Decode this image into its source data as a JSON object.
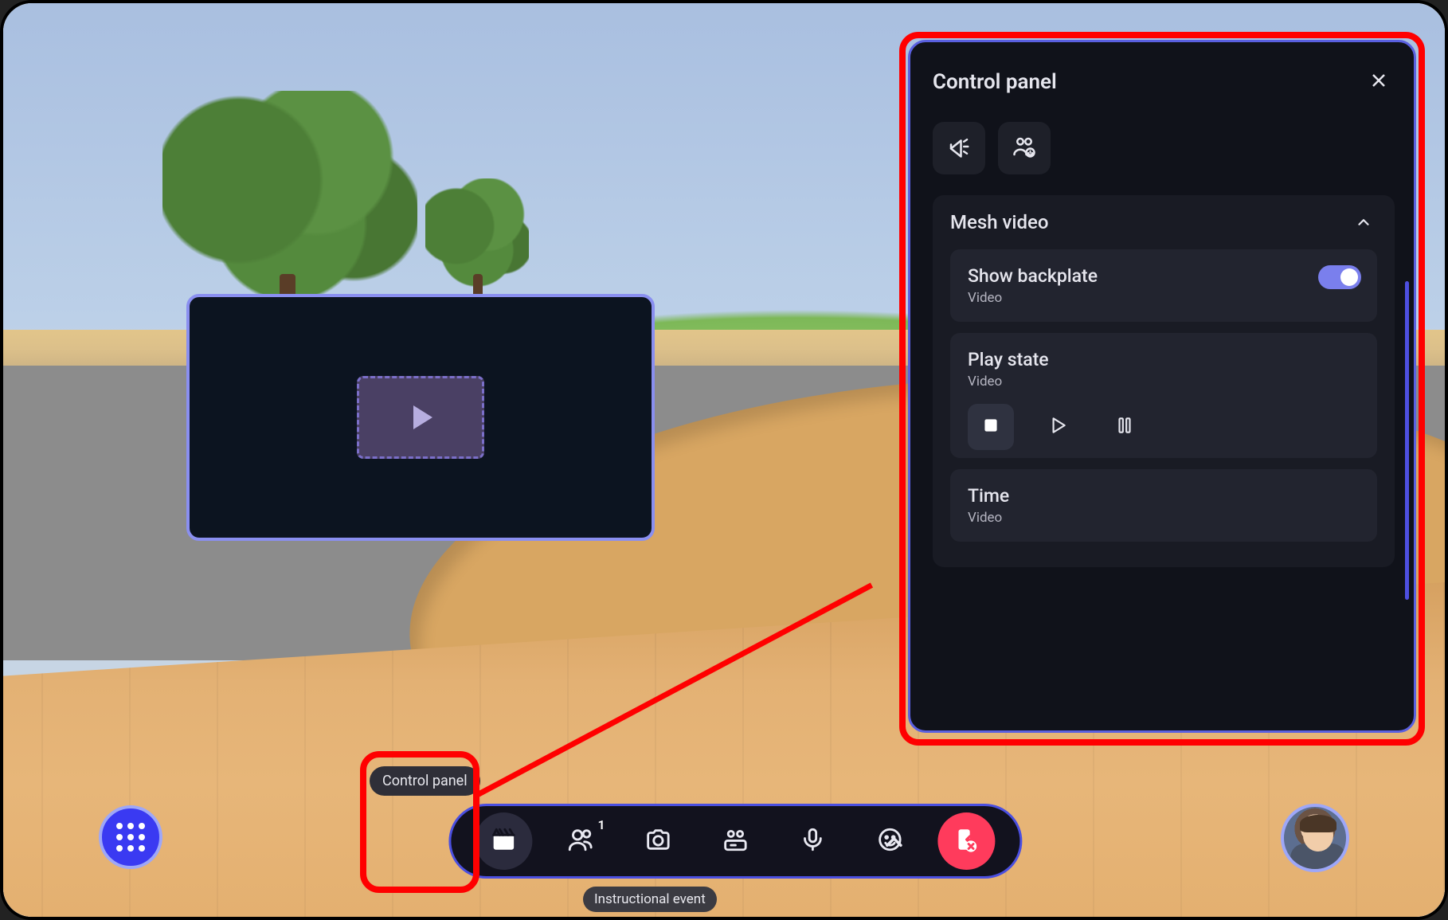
{
  "tooltip": {
    "control_panel": "Control panel",
    "instructional_event": "Instructional event"
  },
  "toolbar": {
    "participant_count": "1"
  },
  "control_panel": {
    "title": "Control panel",
    "section": {
      "mesh_video": {
        "title": "Mesh video",
        "expanded": true,
        "cards": {
          "show_backplate": {
            "label": "Show backplate",
            "sub": "Video",
            "toggle_on": true
          },
          "play_state": {
            "label": "Play state",
            "sub": "Video",
            "current": "stop"
          },
          "time": {
            "label": "Time",
            "sub": "Video"
          }
        }
      }
    }
  }
}
